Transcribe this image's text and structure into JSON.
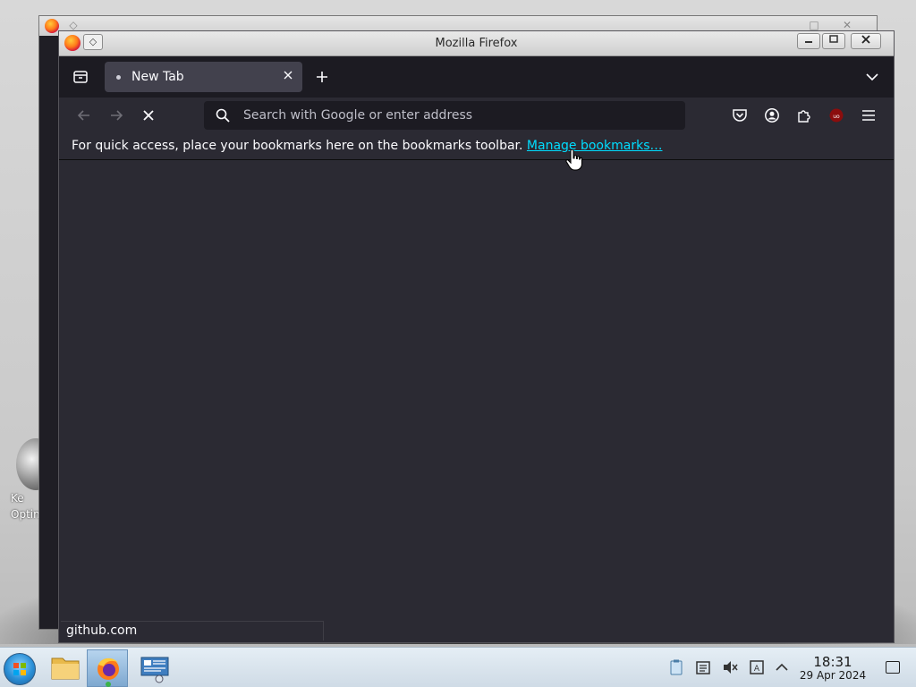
{
  "window": {
    "title": "Mozilla Firefox"
  },
  "tabs": [
    {
      "label": "New Tab",
      "active": true
    }
  ],
  "urlbar": {
    "placeholder": "Search with Google or enter address",
    "value": ""
  },
  "bookmarks_toolbar": {
    "message": "For quick access, place your bookmarks here on the bookmarks toolbar.",
    "link_label": "Manage bookmarks…"
  },
  "status": {
    "text": "github.com"
  },
  "desktop": {
    "icon_label": "Ke\nOptim"
  },
  "taskbar": {
    "time": "18:31",
    "date": "29 Apr 2024"
  },
  "colors": {
    "toolbar_bg": "#2b2a33",
    "tabbar_bg": "#1c1b22",
    "active_tab": "#42414d",
    "link": "#00ddff",
    "ublock_badge": "#8b0d0d"
  },
  "icons": {
    "back": "arrow-left-icon",
    "forward": "arrow-right-icon",
    "stop": "stop-icon",
    "pocket": "pocket-icon",
    "account": "account-icon",
    "extensions": "puzzle-icon",
    "ublock": "ublock-origin-icon",
    "menu": "hamburger-menu-icon"
  }
}
